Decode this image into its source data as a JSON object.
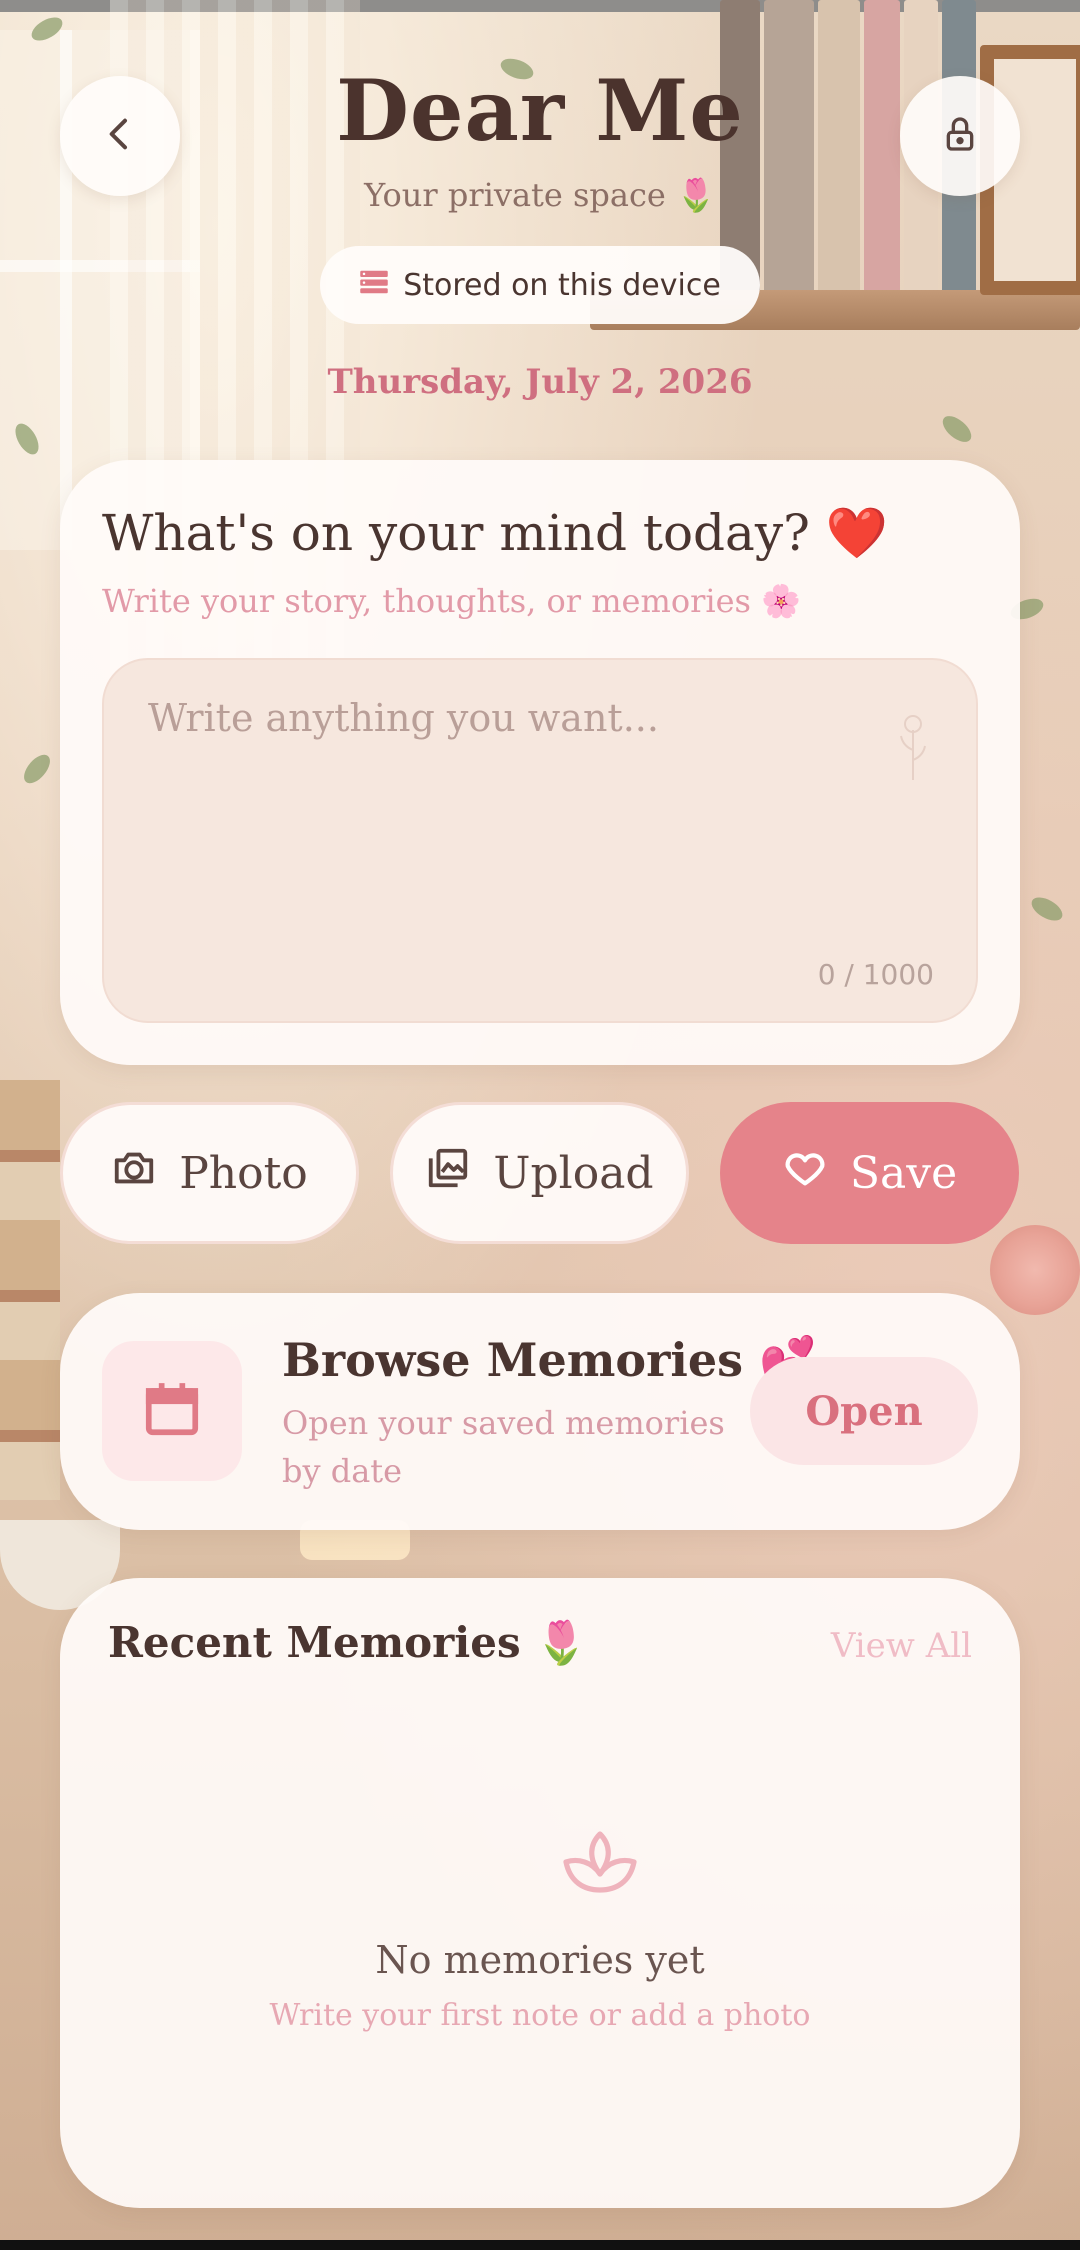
{
  "header": {
    "title": "Dear Me",
    "subtitle": "Your private space 🌷",
    "storage_label": "Stored on this device",
    "date": "Thursday, July 2, 2026",
    "back_icon": "chevron-left-icon",
    "lock_icon": "lock-icon",
    "storage_icon": "database-icon"
  },
  "compose": {
    "title": "What's on your mind today? ❤️",
    "subtitle": "Write your story, thoughts, or memories 🌸",
    "placeholder": "Write anything you want...",
    "value": "",
    "counter": "0 / 1000"
  },
  "actions": {
    "photo_label": "Photo",
    "upload_label": "Upload",
    "save_label": "Save"
  },
  "browse": {
    "title": "Browse Memories 💕",
    "description": "Open your saved memories by date",
    "open_label": "Open"
  },
  "recent": {
    "title": "Recent Memories 🌷",
    "view_all_label": "View All",
    "empty_title": "No memories yet",
    "empty_subtitle": "Write your first note or add a photo"
  },
  "colors": {
    "accent": "#e5838a",
    "accent_text": "#cf6f80",
    "title_text": "#4b332d"
  }
}
